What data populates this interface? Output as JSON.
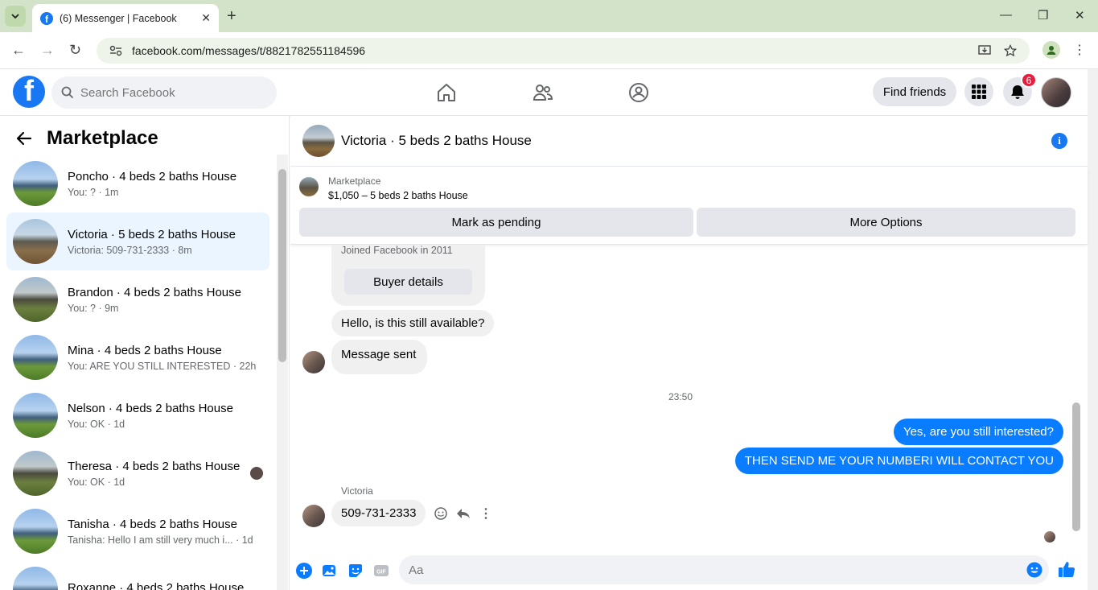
{
  "browser": {
    "tab_title": "(6) Messenger | Facebook",
    "url": "facebook.com/messages/t/8821782551184596"
  },
  "header": {
    "search_placeholder": "Search Facebook",
    "find_friends": "Find friends",
    "notification_count": "6"
  },
  "sidebar": {
    "title": "Marketplace",
    "conversations": [
      {
        "name": "Poncho · 4 beds 2 baths House",
        "preview": "You: ? · 1m"
      },
      {
        "name": "Victoria · 5 beds 2 baths House",
        "preview": "Victoria: 509-731-2333 · 8m"
      },
      {
        "name": "Brandon · 4 beds 2 baths House",
        "preview": "You: ? · 9m"
      },
      {
        "name": "Mina · 4 beds 2 baths House",
        "preview": "You: ARE YOU STILL INTERESTED · 22h"
      },
      {
        "name": "Nelson · 4 beds 2 baths House",
        "preview": "You: OK · 1d"
      },
      {
        "name": "Theresa · 4 beds 2 baths House",
        "preview": "You: OK · 1d"
      },
      {
        "name": "Tanisha · 4 beds 2 baths House",
        "preview": "Tanisha: Hello I am still very much i... · 1d"
      },
      {
        "name": "Roxanne · 4 beds 2 baths House",
        "preview": ""
      }
    ]
  },
  "chat": {
    "title": "Victoria · 5 beds 2 baths House",
    "listing_label": "Marketplace",
    "listing_price": "$1,050 – 5 beds 2 baths House",
    "mark_pending": "Mark as pending",
    "more_options": "More Options",
    "joined": "Joined Facebook in 2011",
    "buyer_details": "Buyer details",
    "msg_available": "Hello, is this still available?",
    "msg_sent": "Message sent",
    "timestamp": "23:50",
    "out1": "Yes, are you still interested?",
    "out2": "THEN SEND ME YOUR NUMBERI WILL CONTACT YOU",
    "sender": "Victoria",
    "reply": "509-731-2333",
    "composer_placeholder": "Aa"
  },
  "colors": {
    "brand": "#1877f2",
    "outgoing_bubble": "#0a7cff",
    "active_row": "#ebf5ff",
    "badge": "#e41e3f"
  }
}
